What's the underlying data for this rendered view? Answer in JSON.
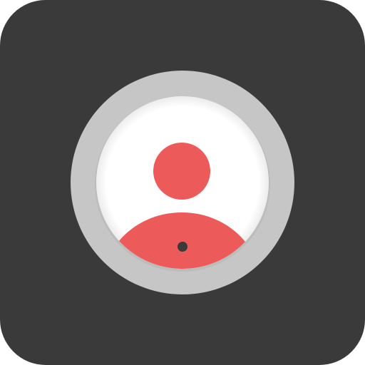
{
  "icon": {
    "name": "contact-avatar-app-icon",
    "glyph": "user-avatar-icon"
  },
  "colors": {
    "background": "#3a3a3a",
    "ring": "#c6c6c6",
    "inner_face": "#ffffff",
    "figure": "#ec5a5a",
    "dot": "#3a3a3a"
  }
}
